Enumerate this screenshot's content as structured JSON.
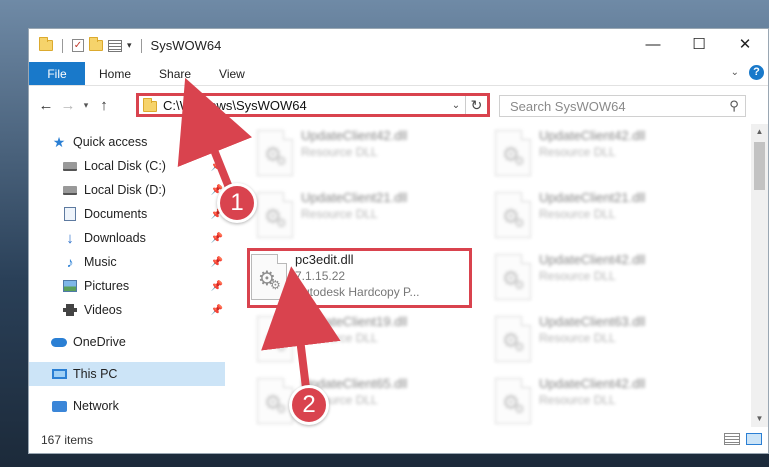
{
  "window": {
    "title": "SysWOW64",
    "buttons": {
      "minimize": "—",
      "maximize": "☐",
      "close": "✕"
    }
  },
  "ribbon": {
    "tabs": [
      "File",
      "Home",
      "Share",
      "View"
    ],
    "help": "?"
  },
  "address": {
    "path": "C:\\Windows\\SysWOW64",
    "search_placeholder": "Search SysWOW64"
  },
  "sidebar": {
    "items": [
      {
        "label": "Quick access",
        "icon": "star-icon"
      },
      {
        "label": "Local Disk (C:)",
        "icon": "disk-icon",
        "pinned": true
      },
      {
        "label": "Local Disk (D:)",
        "icon": "disk-icon",
        "pinned": true
      },
      {
        "label": "Documents",
        "icon": "documents-icon",
        "pinned": true
      },
      {
        "label": "Downloads",
        "icon": "download-icon",
        "pinned": true
      },
      {
        "label": "Music",
        "icon": "music-icon",
        "pinned": true
      },
      {
        "label": "Pictures",
        "icon": "pictures-icon",
        "pinned": true
      },
      {
        "label": "Videos",
        "icon": "videos-icon",
        "pinned": true
      },
      {
        "label": "OneDrive",
        "icon": "cloud-icon"
      },
      {
        "label": "This PC",
        "icon": "computer-icon",
        "selected": true
      },
      {
        "label": "Network",
        "icon": "network-icon"
      }
    ]
  },
  "files": {
    "highlighted": {
      "name": "pc3edit.dll",
      "version": "7.1.15.22",
      "description": "Autodesk Hardcopy P..."
    },
    "blurred": [
      {
        "name": "UpdateClient42.dll",
        "desc": "Resource DLL"
      },
      {
        "name": "UpdateClient42.dll",
        "desc": "Resource DLL"
      },
      {
        "name": "UpdateClient21.dll",
        "desc": "Resource DLL"
      },
      {
        "name": "UpdateClient21.dll",
        "desc": "Resource DLL"
      },
      {
        "name": "UpdateClient42.dll",
        "desc": "Resource DLL"
      },
      {
        "name": "UpdateClient19.dll",
        "desc": "Resource DLL"
      },
      {
        "name": "UpdateClient63.dll",
        "desc": "Resource DLL"
      },
      {
        "name": "UpdateClient65.dll",
        "desc": "Resource DLL"
      },
      {
        "name": "UpdateClient42.dll",
        "desc": "Resource DLL"
      }
    ]
  },
  "status": {
    "item_count": "167 items"
  },
  "callouts": [
    "1",
    "2"
  ],
  "colors": {
    "accent": "#1979ca",
    "highlight": "#d9434e",
    "selected": "#cce4f7"
  }
}
